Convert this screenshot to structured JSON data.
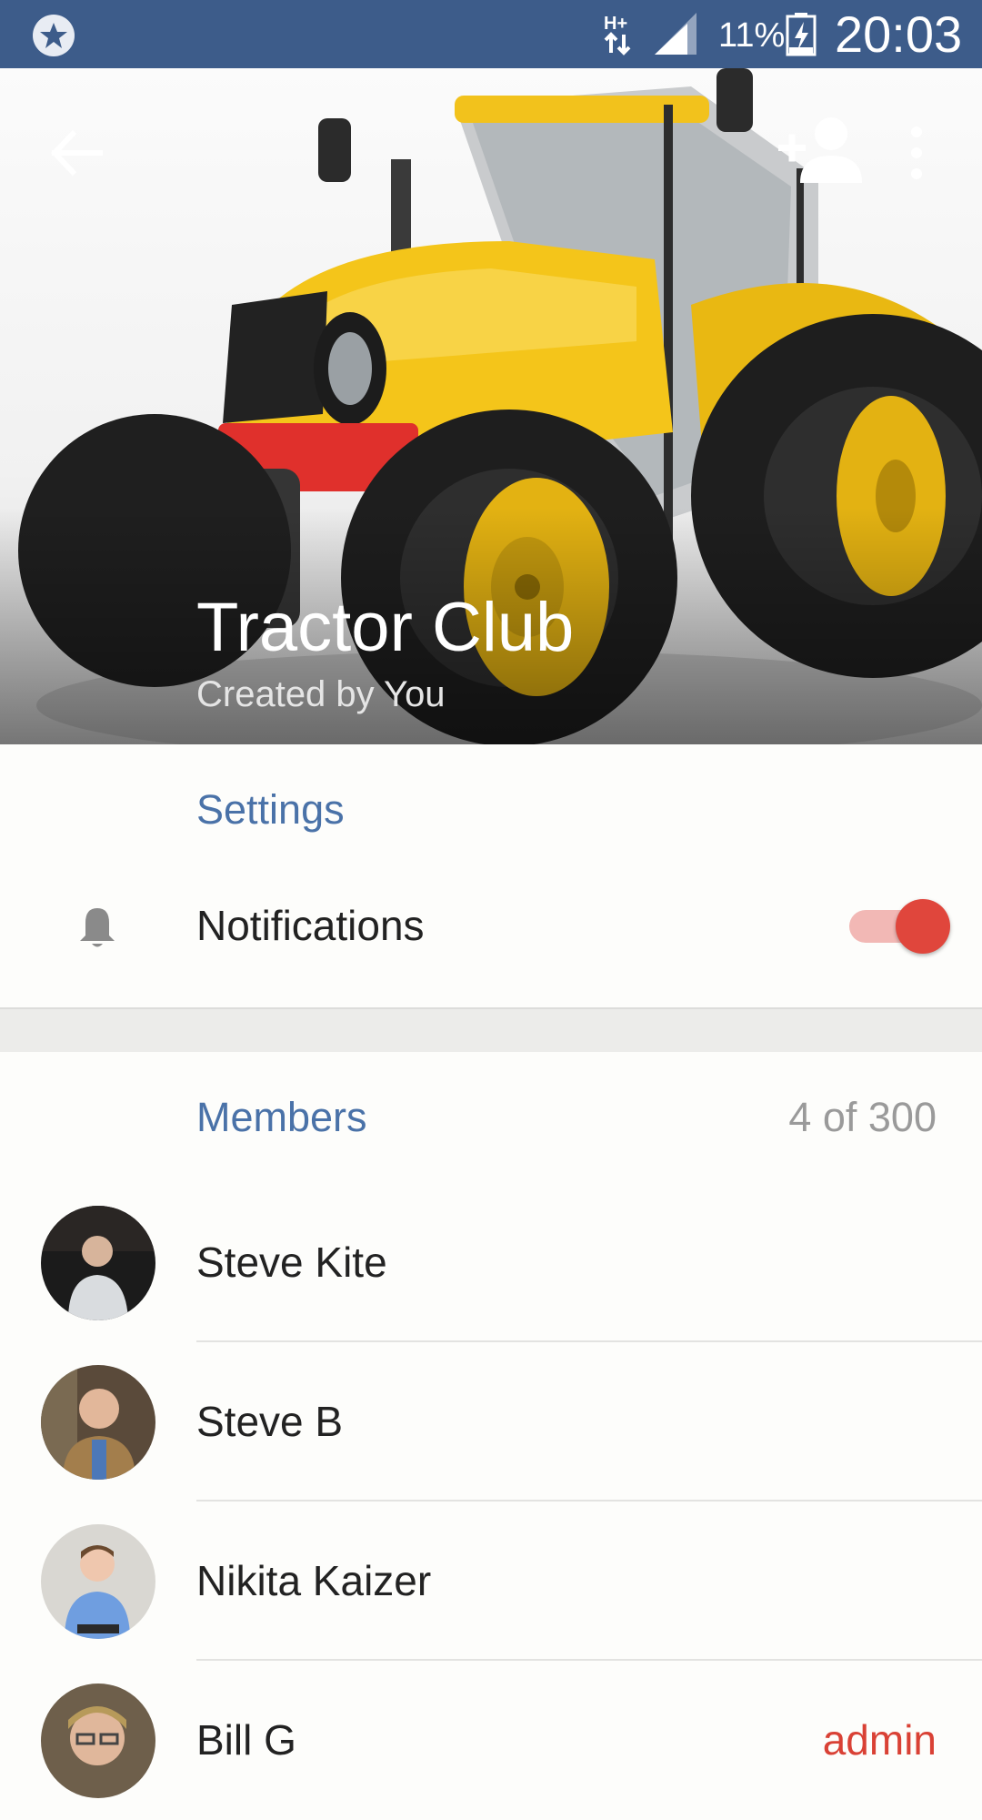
{
  "status_bar": {
    "network": "H+",
    "battery_percent": "11%",
    "time": "20:03"
  },
  "header": {
    "title": "Tractor Club",
    "subtitle": "Created by You",
    "icons": [
      "back-arrow-icon",
      "add-member-icon",
      "more-vert-icon"
    ]
  },
  "settings": {
    "header": "Settings",
    "notifications": {
      "label": "Notifications",
      "enabled": true
    }
  },
  "members": {
    "header": "Members",
    "count": "4 of 300",
    "items": [
      {
        "name": "Steve Kite",
        "role": ""
      },
      {
        "name": "Steve B",
        "role": ""
      },
      {
        "name": "Nikita Kaizer",
        "role": ""
      },
      {
        "name": "Bill G",
        "role": "admin"
      }
    ]
  },
  "colors": {
    "status_bar": "#3d5c8a",
    "accent_blue": "#4a72a8",
    "toggle_red": "#e0463c",
    "admin_red": "#d94135"
  }
}
